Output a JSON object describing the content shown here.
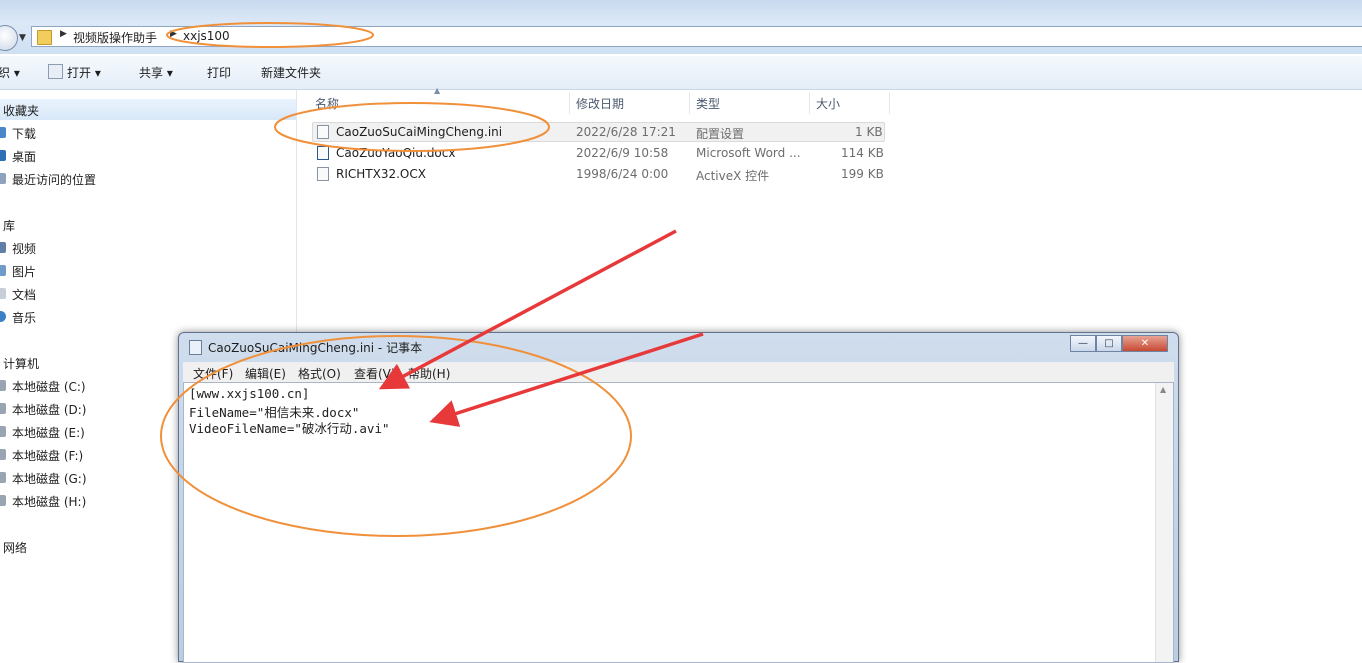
{
  "explorer": {
    "breadcrumb": [
      "视频版操作助手",
      "xxjs100"
    ],
    "toolbar": {
      "organize_label": "",
      "open_label": "打开",
      "share_label": "共享",
      "print_label": "打印",
      "new_folder_label": "新建文件夹"
    },
    "nav": {
      "favorites_label": "收藏夹",
      "favorites": [
        "下载",
        "桌面",
        "最近访问的位置"
      ],
      "libraries_label": "库",
      "libraries": [
        "视频",
        "图片",
        "文档",
        "音乐"
      ],
      "computer_label": "计算机",
      "drives": [
        "本地磁盘 (C:)",
        "本地磁盘 (D:)",
        "本地磁盘 (E:)",
        "本地磁盘 (F:)",
        "本地磁盘 (G:)",
        "本地磁盘 (H:)"
      ],
      "network_label": "网络"
    },
    "columns": {
      "name": "名称",
      "date": "修改日期",
      "type": "类型",
      "size": "大小"
    },
    "files": [
      {
        "name": "CaoZuoSuCaiMingCheng.ini",
        "date": "2022/6/28 17:21",
        "type": "配置设置",
        "size": "1 KB"
      },
      {
        "name": "CaoZuoYaoQiu.docx",
        "date": "2022/6/9 10:58",
        "type": "Microsoft Word ...",
        "size": "114 KB"
      },
      {
        "name": "RICHTX32.OCX",
        "date": "1998/6/24 0:00",
        "type": "ActiveX 控件",
        "size": "199 KB"
      }
    ]
  },
  "notepad": {
    "title": "CaoZuoSuCaiMingCheng.ini - 记事本",
    "menu": [
      "文件(F)",
      "编辑(E)",
      "格式(O)",
      "查看(V)",
      "帮助(H)"
    ],
    "content_lines": [
      "[www.xxjs100.cn]",
      "FileName=\"相信未来.docx\"",
      "VideoFileName=\"破冰行动.avi\""
    ]
  },
  "colors": {
    "annotation_orange": "#f0903a",
    "arrow_red": "#e8393a"
  }
}
